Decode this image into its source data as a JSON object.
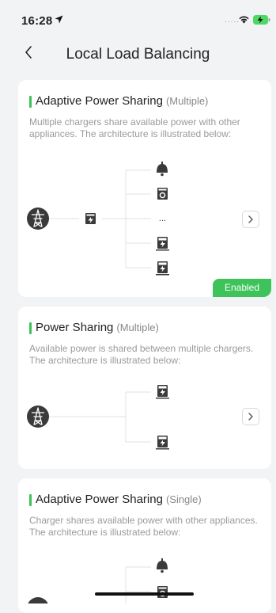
{
  "status_bar": {
    "time": "16:28",
    "dots": "....."
  },
  "nav": {
    "title": "Local Load Balancing"
  },
  "cards": [
    {
      "title": "Adaptive Power Sharing",
      "tag": "(Multiple)",
      "description": "Multiple chargers share available power with other appliances. The architecture is illustrated below:",
      "ellipsis": "...",
      "badge": "Enabled"
    },
    {
      "title": "Power Sharing",
      "tag": "(Multiple)",
      "description": "Available power is shared between multiple chargers. The architecture is illustrated below:"
    },
    {
      "title": "Adaptive Power Sharing",
      "tag": "(Single)",
      "description": "Charger shares available power with other appliances. The architecture is illustrated below:"
    }
  ],
  "colors": {
    "accent": "#3ec25a",
    "icon_dark": "#3a3a3a",
    "background": "#f2f3f5"
  },
  "icons": [
    "location-arrow-icon",
    "wifi-icon",
    "battery-charging-icon",
    "back-chevron-icon",
    "power-tower-icon",
    "meter-icon",
    "lamp-icon",
    "washing-machine-icon",
    "charger-icon",
    "chevron-right-icon"
  ]
}
